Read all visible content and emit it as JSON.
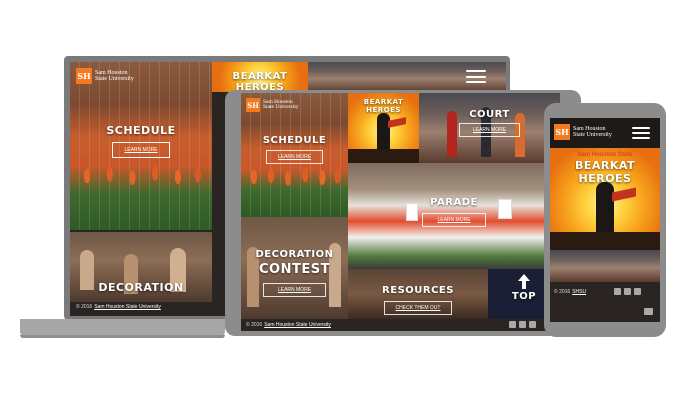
{
  "brand": {
    "logo_mark": "SH",
    "logo_line1": "Sam Houston",
    "logo_line2": "State University"
  },
  "laptop": {
    "tiles": {
      "schedule": "SCHEDULE",
      "learn_more": "LEARN MORE",
      "bearkat": "BEARKAT HEROES",
      "decoration": "DECORATION"
    },
    "footer": {
      "copyright": "© 2016",
      "link": "Sam Houston State University"
    }
  },
  "tablet": {
    "tiles": {
      "schedule": "SCHEDULE",
      "schedule_link": "LEARN MORE",
      "bearkat": "BEARKAT HEROES",
      "court": "COURT",
      "court_link": "LEARN MORE",
      "parade": "PARADE",
      "parade_link": "LEARN MORE",
      "decoration_line1": "DECORATION",
      "decoration_line2": "CONTEST",
      "decoration_link": "LEARN MORE",
      "resources": "RESOURCES",
      "resources_link": "CHECK THEM OUT",
      "top": "TOP"
    },
    "footer": {
      "copyright": "© 2016",
      "link": "Sam Houston State University"
    }
  },
  "phone": {
    "banner_kicker": "Sam Houston State",
    "banner_title": "BEARKAT HEROES",
    "footer": {
      "copyright": "© 2016",
      "link": "SHSU"
    }
  },
  "colors": {
    "brand_orange": "#f47a20",
    "device_gray": "#8c8c8c",
    "screen_dark": "#2a2522"
  }
}
